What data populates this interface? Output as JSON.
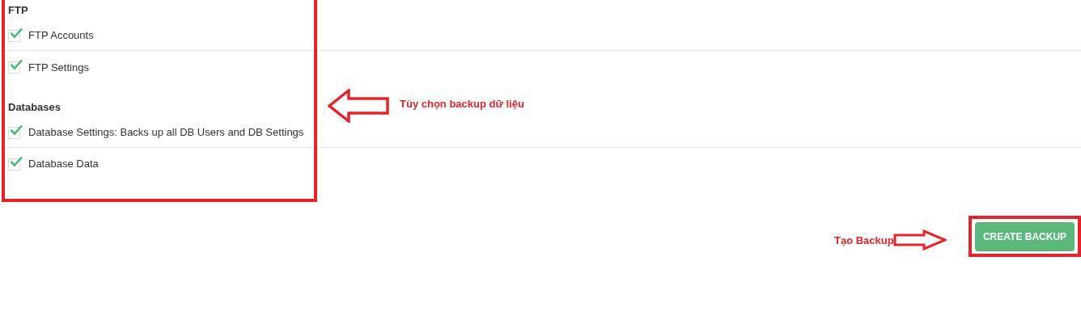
{
  "sections": [
    {
      "title": "FTP",
      "items": [
        {
          "label": "FTP Accounts",
          "checked": true
        },
        {
          "label": "FTP Settings",
          "checked": true
        }
      ]
    },
    {
      "title": "Databases",
      "items": [
        {
          "label": "Database Settings: Backs up all DB Users and DB Settings",
          "checked": true
        },
        {
          "label": "Database Data",
          "checked": true
        }
      ]
    }
  ],
  "create_button": {
    "label": "CREATE BACKUP"
  },
  "annotations": [
    {
      "text": "Tùy chọn backup dữ liệu"
    },
    {
      "text": "Tạo Backup"
    }
  ]
}
